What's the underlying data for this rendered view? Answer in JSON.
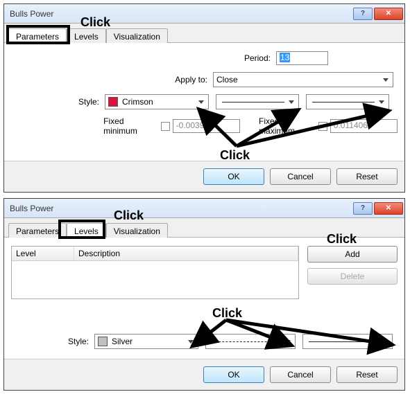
{
  "dialog1": {
    "title": "Bulls Power",
    "tabs": [
      "Parameters",
      "Levels",
      "Visualization"
    ],
    "activeTab": 0,
    "period": {
      "label": "Period:",
      "value": "13"
    },
    "applyto": {
      "label": "Apply to:",
      "value": "Close"
    },
    "style": {
      "label": "Style:",
      "colorName": "Crimson",
      "swatch": "#DC143C"
    },
    "fixedmin": {
      "label": "Fixed minimum",
      "value": "-0.003933"
    },
    "fixedmax": {
      "label": "Fixed maximum",
      "value": "0.011406"
    },
    "buttons": {
      "ok": "OK",
      "cancel": "Cancel",
      "reset": "Reset"
    }
  },
  "dialog2": {
    "title": "Bulls Power",
    "tabs": [
      "Parameters",
      "Levels",
      "Visualization"
    ],
    "activeTab": 1,
    "table": {
      "col1": "Level",
      "col2": "Description"
    },
    "add": "Add",
    "delete": "Delete",
    "style": {
      "label": "Style:",
      "colorName": "Silver",
      "swatch": "#C0C0C0"
    },
    "buttons": {
      "ok": "OK",
      "cancel": "Cancel",
      "reset": "Reset"
    }
  },
  "annotations": {
    "click": "Click"
  }
}
